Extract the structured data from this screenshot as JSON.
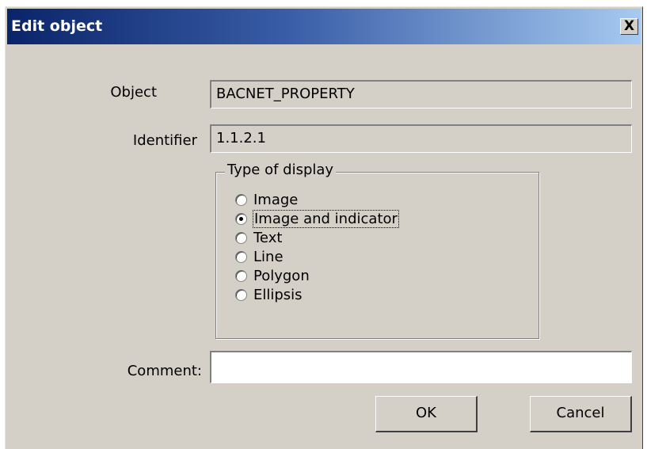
{
  "window": {
    "title": "Edit object",
    "close_label": "X"
  },
  "form": {
    "object_label": "Object",
    "object_value": "BACNET_PROPERTY",
    "identifier_label": "Identifier",
    "identifier_value": "1.1.2.1",
    "comment_label": "Comment:",
    "comment_value": ""
  },
  "display_type": {
    "legend": "Type of display",
    "selected": "Image and indicator",
    "options": [
      {
        "label": "Image",
        "checked": false
      },
      {
        "label": "Image and indicator",
        "checked": true
      },
      {
        "label": "Text",
        "checked": false
      },
      {
        "label": "Line",
        "checked": false
      },
      {
        "label": "Polygon",
        "checked": false
      },
      {
        "label": "Ellipsis",
        "checked": false
      }
    ]
  },
  "buttons": {
    "ok": "OK",
    "cancel": "Cancel"
  }
}
